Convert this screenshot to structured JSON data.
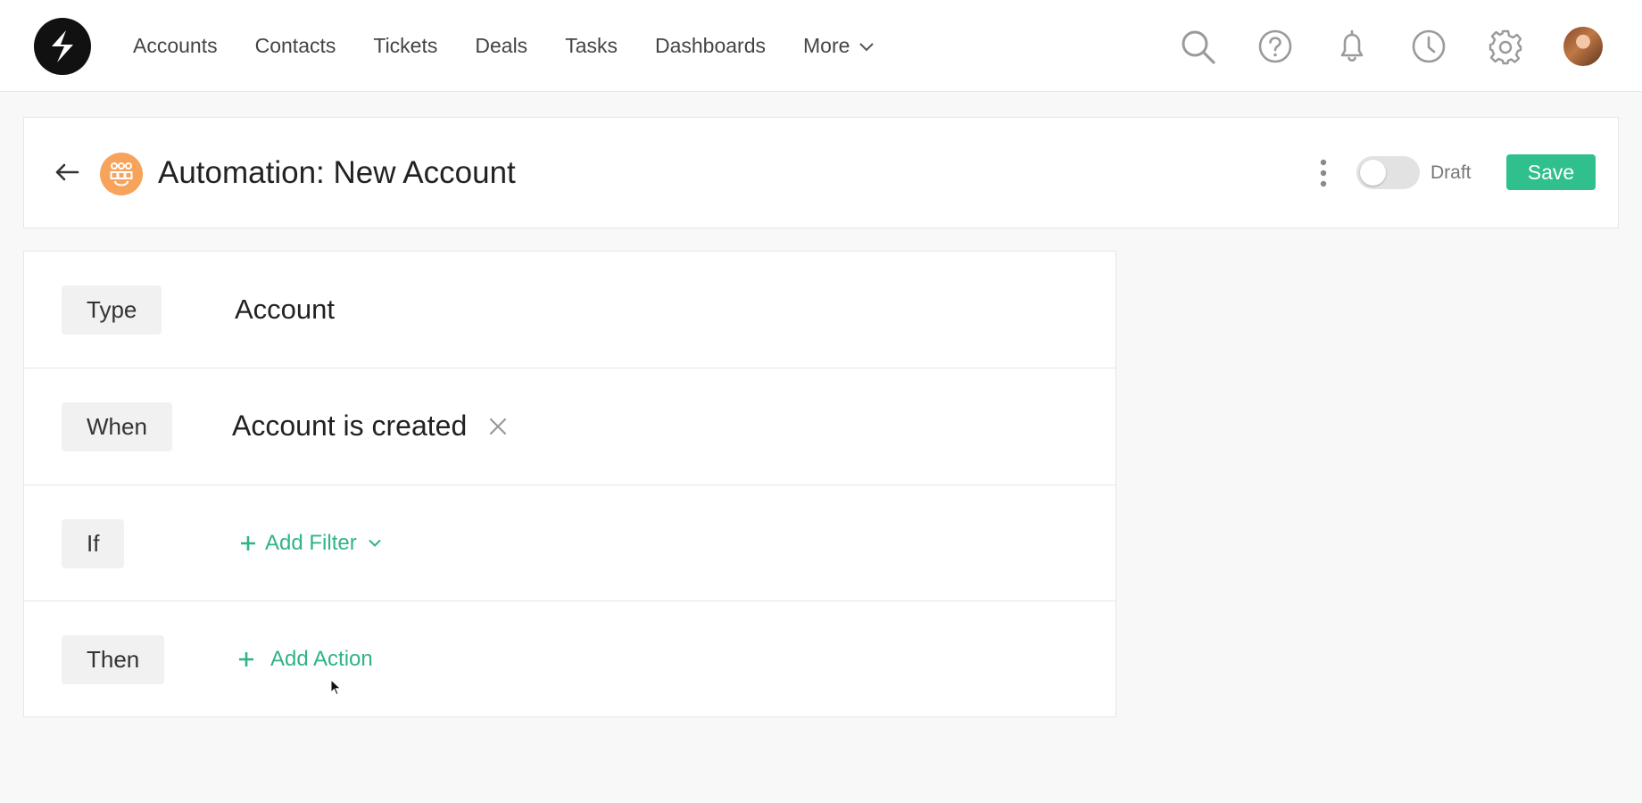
{
  "nav": {
    "items": [
      "Accounts",
      "Contacts",
      "Tickets",
      "Deals",
      "Tasks",
      "Dashboards"
    ],
    "more_label": "More"
  },
  "header": {
    "title": "Automation: New Account",
    "toggle_state": "off",
    "toggle_label": "Draft",
    "save_label": "Save"
  },
  "rule": {
    "type": {
      "label": "Type",
      "value": "Account"
    },
    "when": {
      "label": "When",
      "value": "Account is created"
    },
    "if": {
      "label": "If",
      "action_label": "Add Filter"
    },
    "then": {
      "label": "Then",
      "action_label": "Add Action"
    }
  },
  "colors": {
    "accent_green": "#2fc08d",
    "link_green": "#2fb484",
    "automation_icon": "#f7a35c",
    "logo": "#111111"
  },
  "icons": [
    "logo",
    "chevron-down-icon",
    "search-icon",
    "help-icon",
    "bell-icon",
    "history-icon",
    "gear-icon",
    "avatar",
    "back-arrow-icon",
    "automation-icon",
    "kebab-icon",
    "close-icon",
    "plus-icon"
  ]
}
